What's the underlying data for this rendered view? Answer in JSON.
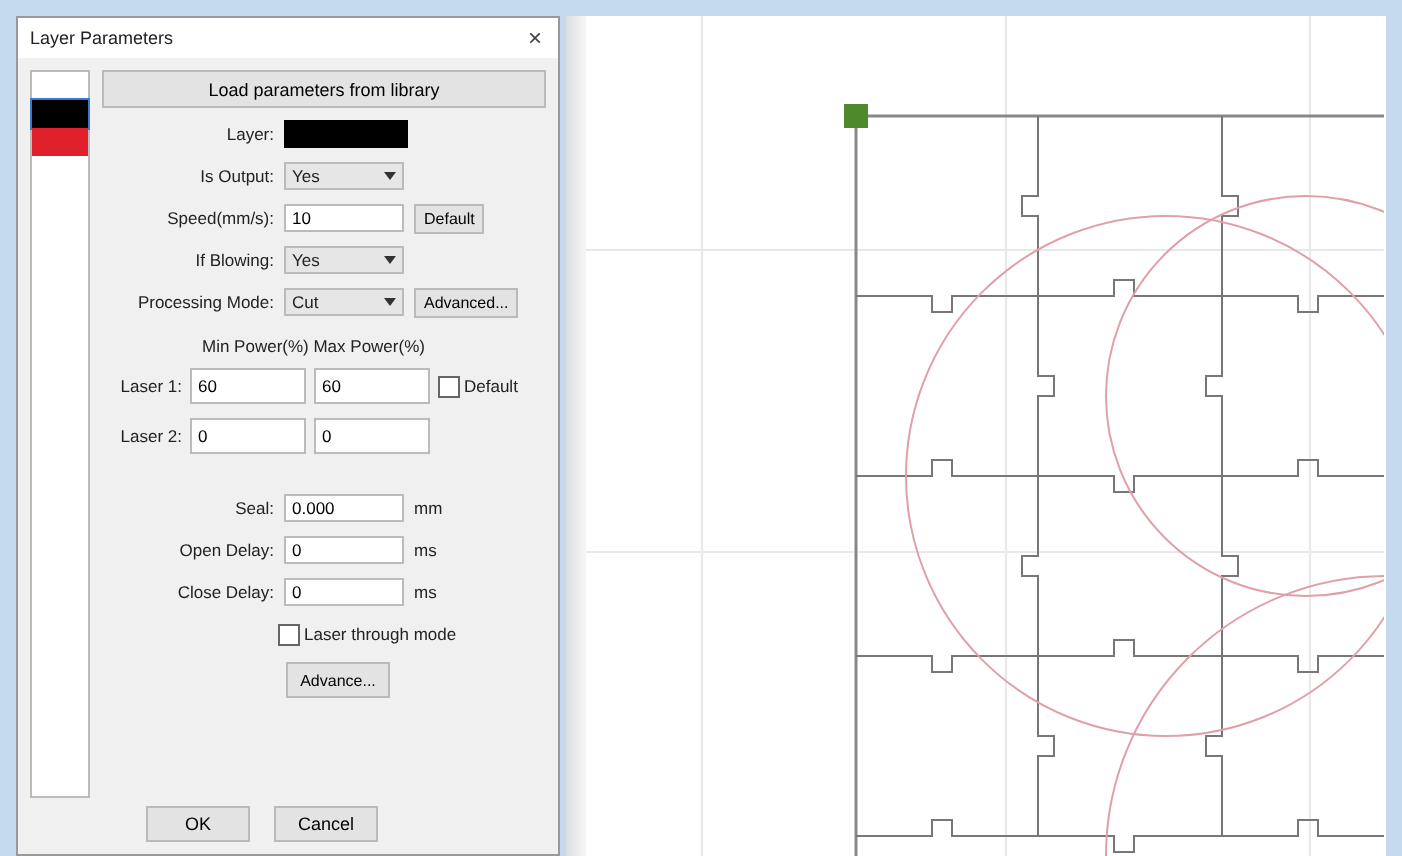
{
  "dialog": {
    "title": "Layer Parameters",
    "close": "×",
    "layers": [
      {
        "color": "#000000",
        "selected": true
      },
      {
        "color": "#e0202a",
        "selected": false
      }
    ],
    "library_button": "Load parameters from library",
    "fields": [
      {
        "kind": "color",
        "label": "Layer:",
        "color": "#000000"
      },
      {
        "kind": "select",
        "label": "Is Output:",
        "value": "Yes"
      },
      {
        "kind": "input",
        "label": "Speed(mm/s):",
        "value": "10",
        "button": "Default"
      },
      {
        "kind": "select",
        "label": "If Blowing:",
        "value": "Yes"
      },
      {
        "kind": "select",
        "label": "Processing Mode:",
        "value": "Cut",
        "button": "Advanced..."
      }
    ],
    "power_header": "Min Power(%) Max Power(%)",
    "lasers": [
      {
        "label": "Laser 1:",
        "min": "60",
        "max": "60",
        "checkbox": {
          "label": "Default",
          "checked": false
        }
      },
      {
        "label": "Laser 2:",
        "min": "0",
        "max": "0"
      }
    ],
    "timing": [
      {
        "label": "Seal:",
        "value": "0.000",
        "unit": "mm"
      },
      {
        "label": "Open Delay:",
        "value": "0",
        "unit": "ms"
      },
      {
        "label": "Close Delay:",
        "value": "0",
        "unit": "ms"
      }
    ],
    "through_mode": {
      "label": "Laser through mode",
      "checked": false
    },
    "advance_button": "Advance...",
    "buttons": [
      "OK",
      "Cancel"
    ]
  }
}
